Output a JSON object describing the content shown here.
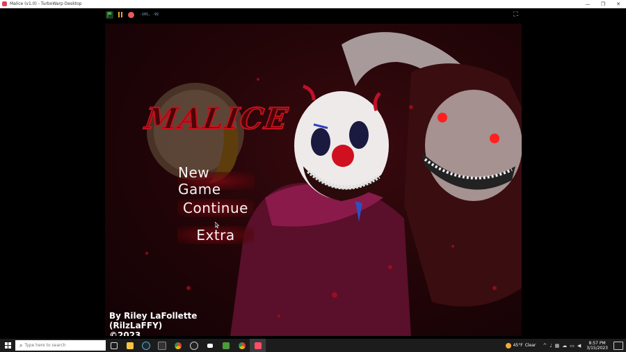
{
  "window": {
    "title": "Malice (v1.0) - TurboWarp Desktop",
    "minimize": "—",
    "maximize": "❐",
    "close": "✕"
  },
  "player": {
    "mouse_readout": "-101, -92",
    "fullscreen_glyph": "⛶"
  },
  "game": {
    "logo": "MALICE",
    "menu": [
      "New Game",
      "Continue",
      "Extra"
    ],
    "credits": [
      "By Riley LaFollette",
      "(RilzLaFFY)",
      "©2023"
    ]
  },
  "taskbar": {
    "search_placeholder": "Type here to search",
    "weather_temp": "45°F",
    "weather_desc": "Clear",
    "time": "8:57 PM",
    "date": "3/15/2023",
    "pinned_icons": [
      "task-view-icon",
      "file-explorer-icon",
      "steam-icon",
      "terminal-icon",
      "chrome-icon",
      "obs-icon",
      "epic-icon",
      "minecraft-icon",
      "chrome-icon",
      "turbowarp-icon"
    ]
  },
  "colors": {
    "flag": "#4caf50",
    "pause": "#f0a81a",
    "stop": "#ec5959",
    "stage_bg": "#240508",
    "logo_stroke": "#c4121d"
  }
}
